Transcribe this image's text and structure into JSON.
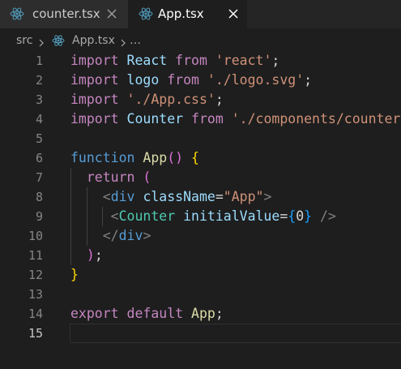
{
  "colors": {
    "editor_bg": "#1e1e1e",
    "tabbar_bg": "#252526",
    "react_icon": "#519aba",
    "keyword_import": "#c586c0",
    "keyword": "#569cd6",
    "string": "#ce9178",
    "function": "#dcdcaa",
    "type": "#4ec9b0",
    "variable": "#9cdcfe",
    "bracket_level1": "#ffd700",
    "bracket_level2": "#da70d6",
    "bracket_level3": "#179fff"
  },
  "tabs": [
    {
      "label": "counter.tsx",
      "icon": "react-icon",
      "active": false
    },
    {
      "label": "App.tsx",
      "icon": "react-icon",
      "active": true
    }
  ],
  "breadcrumb": {
    "folder": "src",
    "file": "App.tsx",
    "more": "…"
  },
  "editor": {
    "current_line": 15,
    "lines": [
      {
        "n": "1",
        "text": "import React from 'react';"
      },
      {
        "n": "2",
        "text": "import logo from './logo.svg';"
      },
      {
        "n": "3",
        "text": "import './App.css';"
      },
      {
        "n": "4",
        "text": "import Counter from './components/counter';"
      },
      {
        "n": "5",
        "text": ""
      },
      {
        "n": "6",
        "text": "function App() {"
      },
      {
        "n": "7",
        "text": "  return ("
      },
      {
        "n": "8",
        "text": "    <div className=\"App\">"
      },
      {
        "n": "9",
        "text": "     <Counter initialValue={0} />"
      },
      {
        "n": "10",
        "text": "    </div>"
      },
      {
        "n": "11",
        "text": "  );"
      },
      {
        "n": "12",
        "text": "}"
      },
      {
        "n": "13",
        "text": ""
      },
      {
        "n": "14",
        "text": "export default App;"
      },
      {
        "n": "15",
        "text": ""
      }
    ]
  }
}
